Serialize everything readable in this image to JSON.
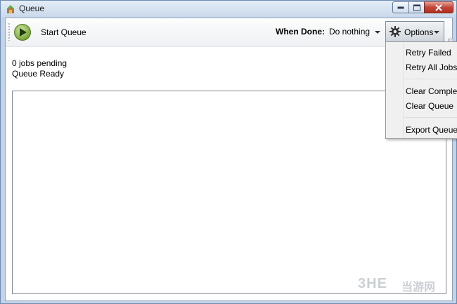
{
  "window": {
    "title": "Queue"
  },
  "toolbar": {
    "start_label": "Start Queue",
    "when_done_label": "When Done:",
    "when_done_value": "Do nothing",
    "options_label": "Options"
  },
  "status": {
    "pending": "0 jobs pending",
    "ready": "Queue Ready"
  },
  "options_menu": {
    "items": [
      {
        "label": "Retry Failed"
      },
      {
        "label": "Retry All Jobs"
      },
      {
        "label": "Clear Complete"
      },
      {
        "label": "Clear Queue"
      },
      {
        "label": "Export Queue"
      }
    ]
  },
  "watermark": {
    "latin": "3HE",
    "cjk": "当游网"
  },
  "colors": {
    "play": "#7ba53a",
    "close": "#c2463a",
    "accent": "#6e8bb0"
  }
}
